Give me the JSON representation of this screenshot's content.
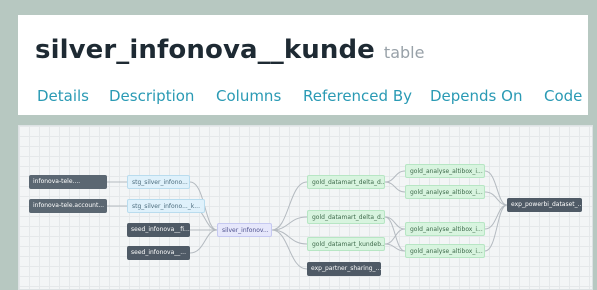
{
  "header": {
    "title": "silver_infonova__kunde",
    "resource_type": "table"
  },
  "tabs": [
    "Details",
    "Description",
    "Columns",
    "Referenced By",
    "Depends On",
    "Code"
  ],
  "lineage": {
    "nodes": {
      "src_tele": "infonova-tele....",
      "src_tele_account": "infonova-tele.account...",
      "stg_1": "stg_silver_infono...",
      "stg_2": "stg_silver_infono..._k...",
      "seed_1": "seed_infonova__fi...",
      "seed_2": "seed_infonova__...",
      "current": "silver_infonov...",
      "gold_dm_delta_1": "gold_datamart_delta_d...",
      "gold_dm_delta_2": "gold_datamart_delta_d...",
      "gold_dm_kunde": "gold_datamart_kundeb...",
      "exp_partner": "exp_partner_sharing_...",
      "gold_an_1": "gold_analyse_altibox_i...",
      "gold_an_2": "gold_analyse_altibox_i...",
      "gold_an_3": "gold_analyse_altibox_i...",
      "gold_an_4": "gold_analyse_altibox_i...",
      "exp_powerbi": "exp_powerbi_dataset_..."
    }
  }
}
